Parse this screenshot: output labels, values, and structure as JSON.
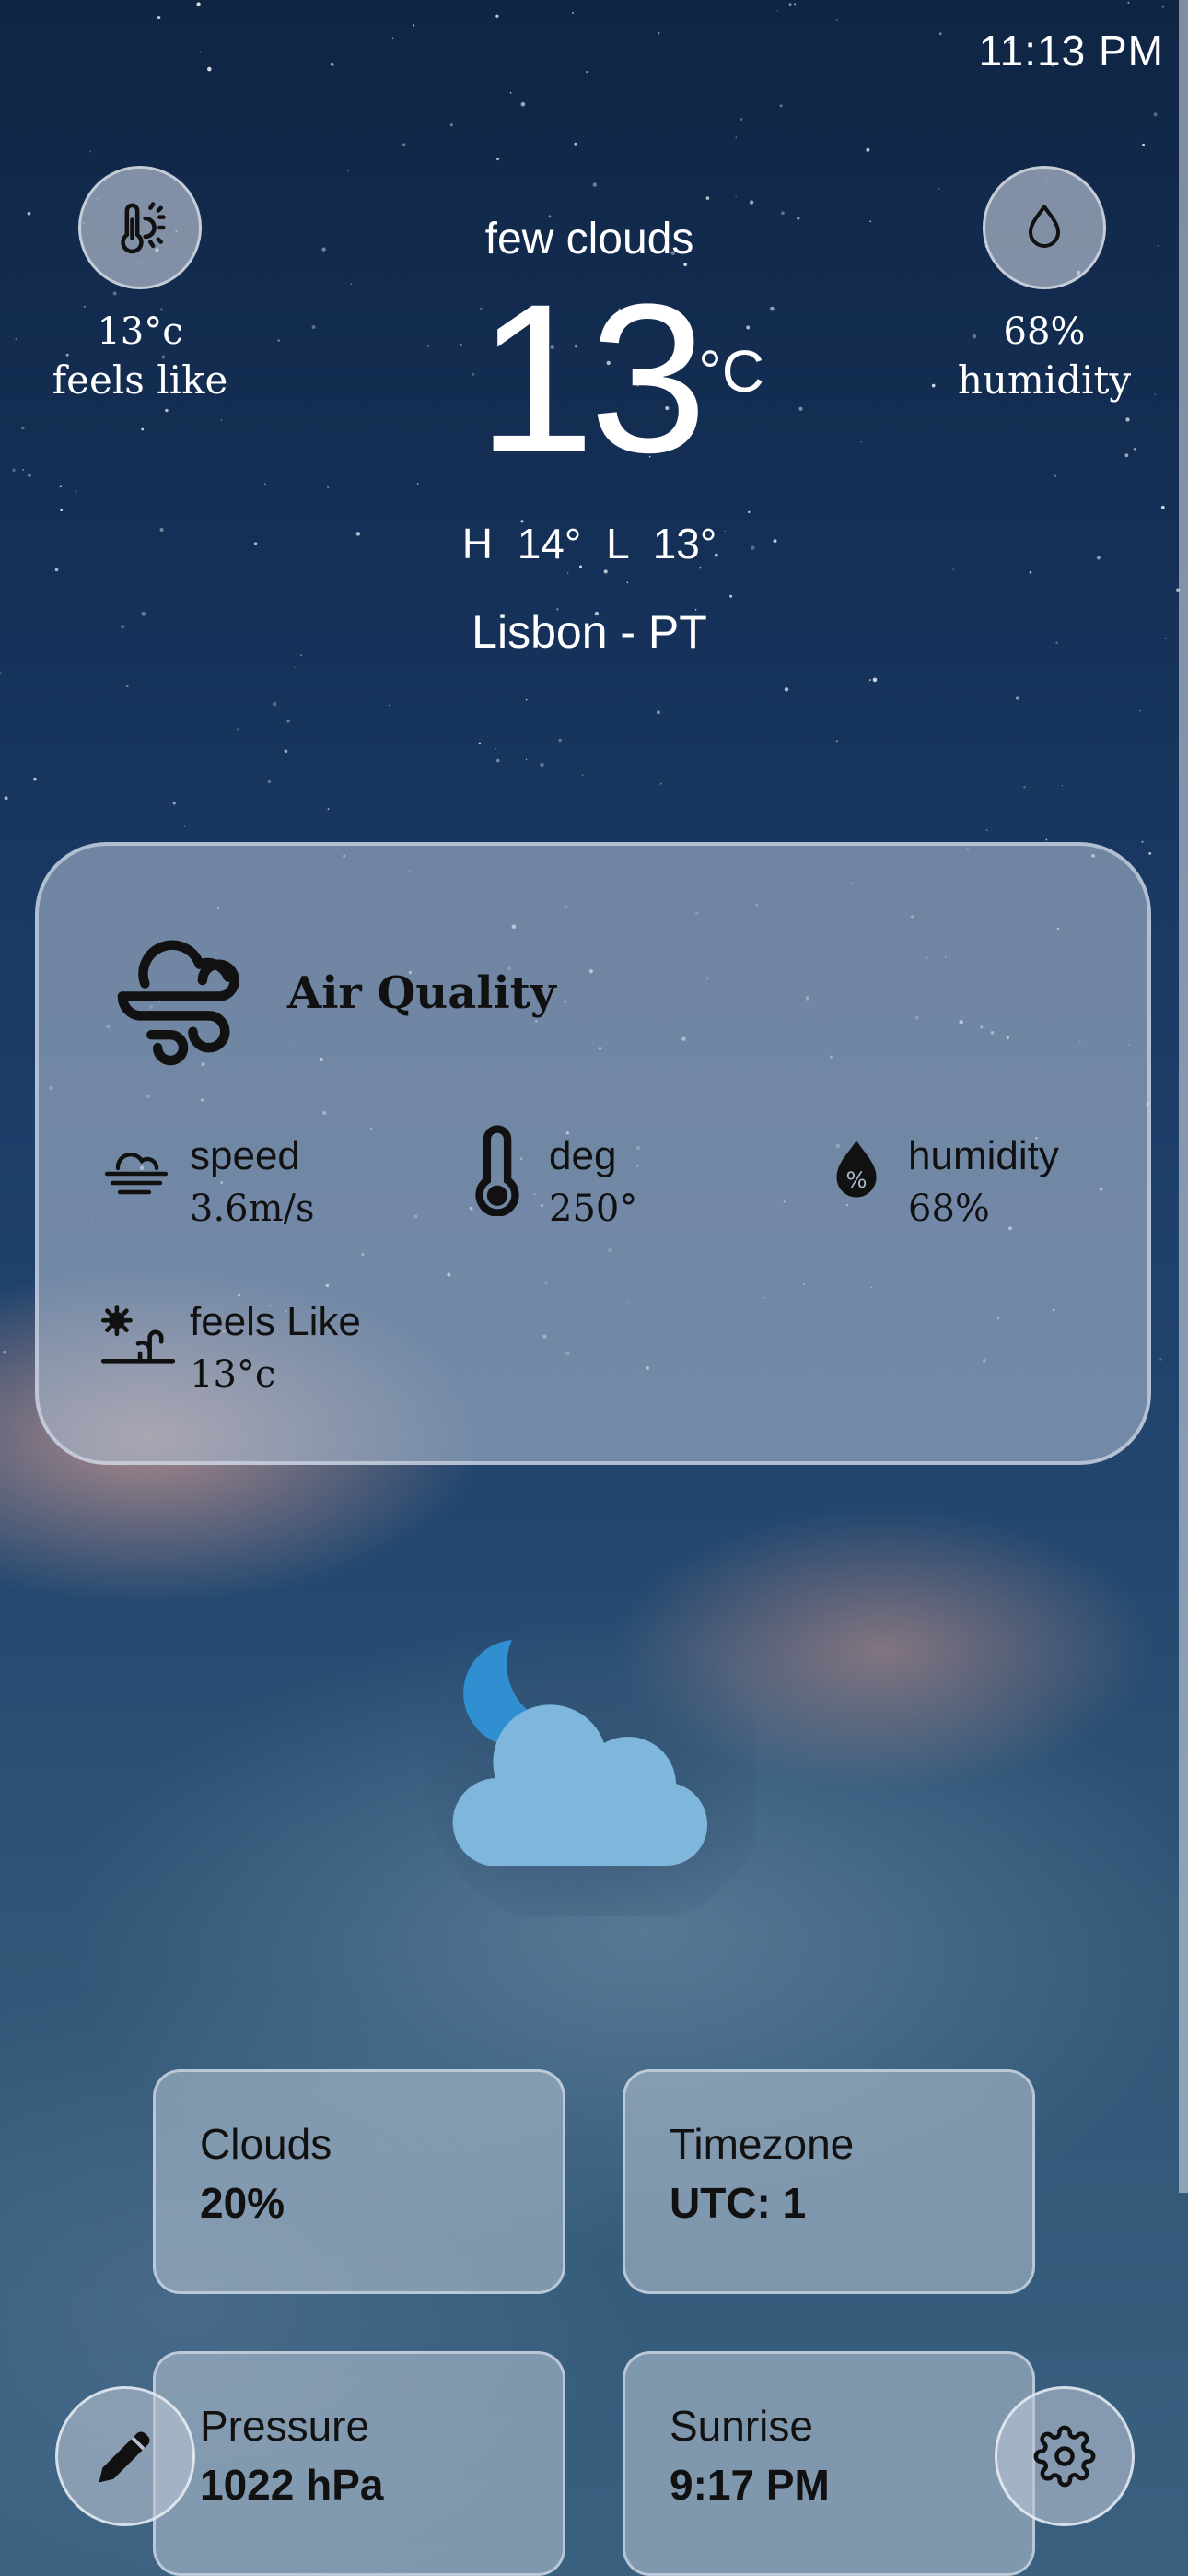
{
  "status_bar": {
    "time": "11:13 PM"
  },
  "feels_like": {
    "value": "13°c",
    "label": "feels like",
    "icon": "thermometer-sun-icon"
  },
  "humidity": {
    "value": "68%",
    "label": "humidity",
    "icon": "droplet-icon"
  },
  "current": {
    "description": "few clouds",
    "temperature": "13",
    "unit": "°C",
    "high": "H 14°",
    "low": "L 13°",
    "location": "Lisbon - PT",
    "icon": "cloud-moon-icon"
  },
  "air_quality": {
    "title": "Air Quality",
    "items": [
      {
        "label": "speed",
        "value": "3.6m/s",
        "icon": "wind-cloud-icon"
      },
      {
        "label": "deg",
        "value": "250°",
        "icon": "thermometer-icon"
      },
      {
        "label": "humidity",
        "value": "68%",
        "icon": "humidity-drop-icon"
      },
      {
        "label": "feels Like",
        "value": "13°c",
        "icon": "sun-plant-icon"
      }
    ]
  },
  "tiles": [
    {
      "title": "Clouds",
      "value": "20%"
    },
    {
      "title": "Timezone",
      "value": "UTC: 1"
    },
    {
      "title": "Pressure",
      "value": "1022 hPa"
    },
    {
      "title": "Sunrise",
      "value": "9:17 PM"
    }
  ],
  "actions": {
    "edit_icon": "pencil-icon",
    "settings_icon": "gear-icon"
  },
  "colors": {
    "cloud": "#7fb6dc",
    "moon": "#2f8fd0",
    "card": "#aab9cd"
  }
}
